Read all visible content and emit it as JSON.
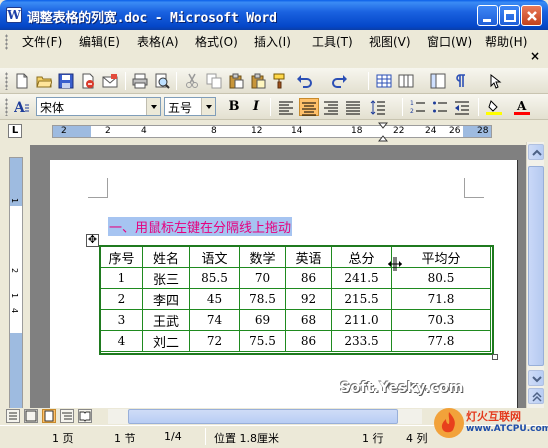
{
  "window": {
    "title": "调整表格的列宽.doc - Microsoft Word"
  },
  "menu": {
    "items": [
      "文件(F)",
      "编辑(E)",
      "表格(A)",
      "格式(O)",
      "插入(I)",
      "工具(T)",
      "视图(V)",
      "窗口(W)",
      "帮助(H)"
    ],
    "close_glyph": "×"
  },
  "toolbar": {
    "icons": [
      "new-document-icon",
      "open-icon",
      "save-icon",
      "permission-icon",
      "email-icon",
      "print-icon",
      "print-preview-icon",
      "cut-icon",
      "copy-icon",
      "paste-icon",
      "paste-special-icon",
      "format-painter-icon",
      "undo-icon",
      "redo-icon",
      "insert-table-icon",
      "insert-columns-icon",
      "document-map-icon",
      "show-hide-icon"
    ]
  },
  "format": {
    "style_value": "宋体",
    "size_value": "五号",
    "bold": "B",
    "italic": "I",
    "align": "center",
    "highlight_color": "#ffff00",
    "font_color": "#ff0000"
  },
  "ruler": {
    "top_numbers": [
      "2",
      "2",
      "4",
      "8",
      "12",
      "14",
      "18",
      "22",
      "24",
      "26",
      "28"
    ],
    "left_numbers": [
      "1",
      "2",
      "1",
      "4"
    ],
    "corner": "L"
  },
  "document": {
    "heading": "一、用鼠标左键在分隔线上拖动",
    "table": {
      "headers": [
        "序号",
        "姓名",
        "语文",
        "数学",
        "英语",
        "总分",
        "平均分"
      ],
      "rows": [
        [
          "1",
          "张三",
          "85.5",
          "70",
          "86",
          "241.5",
          "80.5"
        ],
        [
          "2",
          "李四",
          "45",
          "78.5",
          "92",
          "215.5",
          "71.8"
        ],
        [
          "3",
          "王武",
          "74",
          "69",
          "68",
          "211.0",
          "70.3"
        ],
        [
          "4",
          "刘二",
          "72",
          "75.5",
          "86",
          "233.5",
          "77.8"
        ]
      ]
    },
    "watermark": "Soft.Yesky.com"
  },
  "status": {
    "page": "1 页",
    "section": "1 节",
    "page_of": "1/4",
    "position": "位置 1.8厘米",
    "line": "1 行",
    "column": "4 列"
  },
  "corner_logo": {
    "name": "灯火互联网",
    "url": "www.ATCPU.com"
  },
  "colors": {
    "title_bar": "#0a5fe8",
    "table_border": "#1f8a1f",
    "heading_text": "#e6007e",
    "heading_highlight": "#a6c4f1"
  }
}
